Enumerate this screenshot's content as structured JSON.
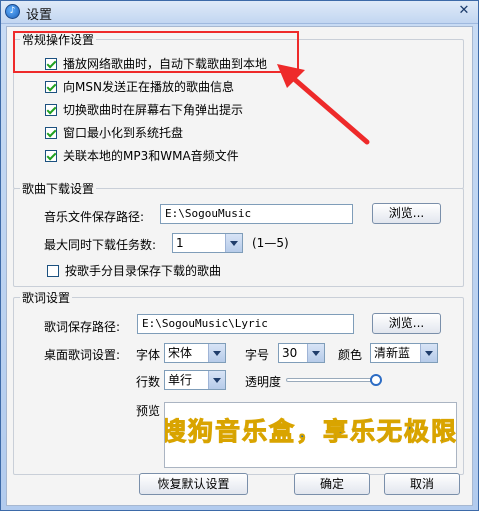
{
  "window": {
    "title": "设置",
    "close_glyph": "✕",
    "icon_glyph": "♪"
  },
  "general": {
    "legend": "常规操作设置",
    "options": [
      {
        "label": "播放网络歌曲时，自动下载歌曲到本地",
        "checked": true
      },
      {
        "label": "向MSN发送正在播放的歌曲信息",
        "checked": true
      },
      {
        "label": "切换歌曲时在屏幕右下角弹出提示",
        "checked": true
      },
      {
        "label": "窗口最小化到系统托盘",
        "checked": true
      },
      {
        "label": "关联本地的MP3和WMA音频文件",
        "checked": true
      }
    ]
  },
  "download": {
    "legend": "歌曲下载设置",
    "save_path_label": "音乐文件保存路径:",
    "save_path_value": "E:\\SogouMusic",
    "browse_label": "浏览...",
    "max_tasks_label": "最大同时下载任务数:",
    "max_tasks_value": "1",
    "max_tasks_range": "(1—5)",
    "by_folder_label": "按歌手分目录保存下载的歌曲",
    "by_folder_checked": false
  },
  "lyrics": {
    "legend": "歌词设置",
    "save_path_label": "歌词保存路径:",
    "save_path_value": "E:\\SogouMusic\\Lyric",
    "browse_label": "浏览...",
    "desktop_label": "桌面歌词设置:",
    "font_label": "字体",
    "font_value": "宋体",
    "size_label": "字号",
    "size_value": "30",
    "color_label": "颜色",
    "color_value": "清新蓝",
    "lines_label": "行数",
    "lines_value": "单行",
    "opacity_label": "透明度",
    "opacity_level": 0.97,
    "preview_label": "预览",
    "preview_text": "搜狗音乐盒，享乐无极限"
  },
  "footer": {
    "restore_label": "恢复默认设置",
    "ok_label": "确定",
    "cancel_label": "取消"
  },
  "colors": {
    "annotation": "#ee2a2a",
    "preview_text": "#1c6fb8",
    "preview_outline": "#d9a400"
  }
}
